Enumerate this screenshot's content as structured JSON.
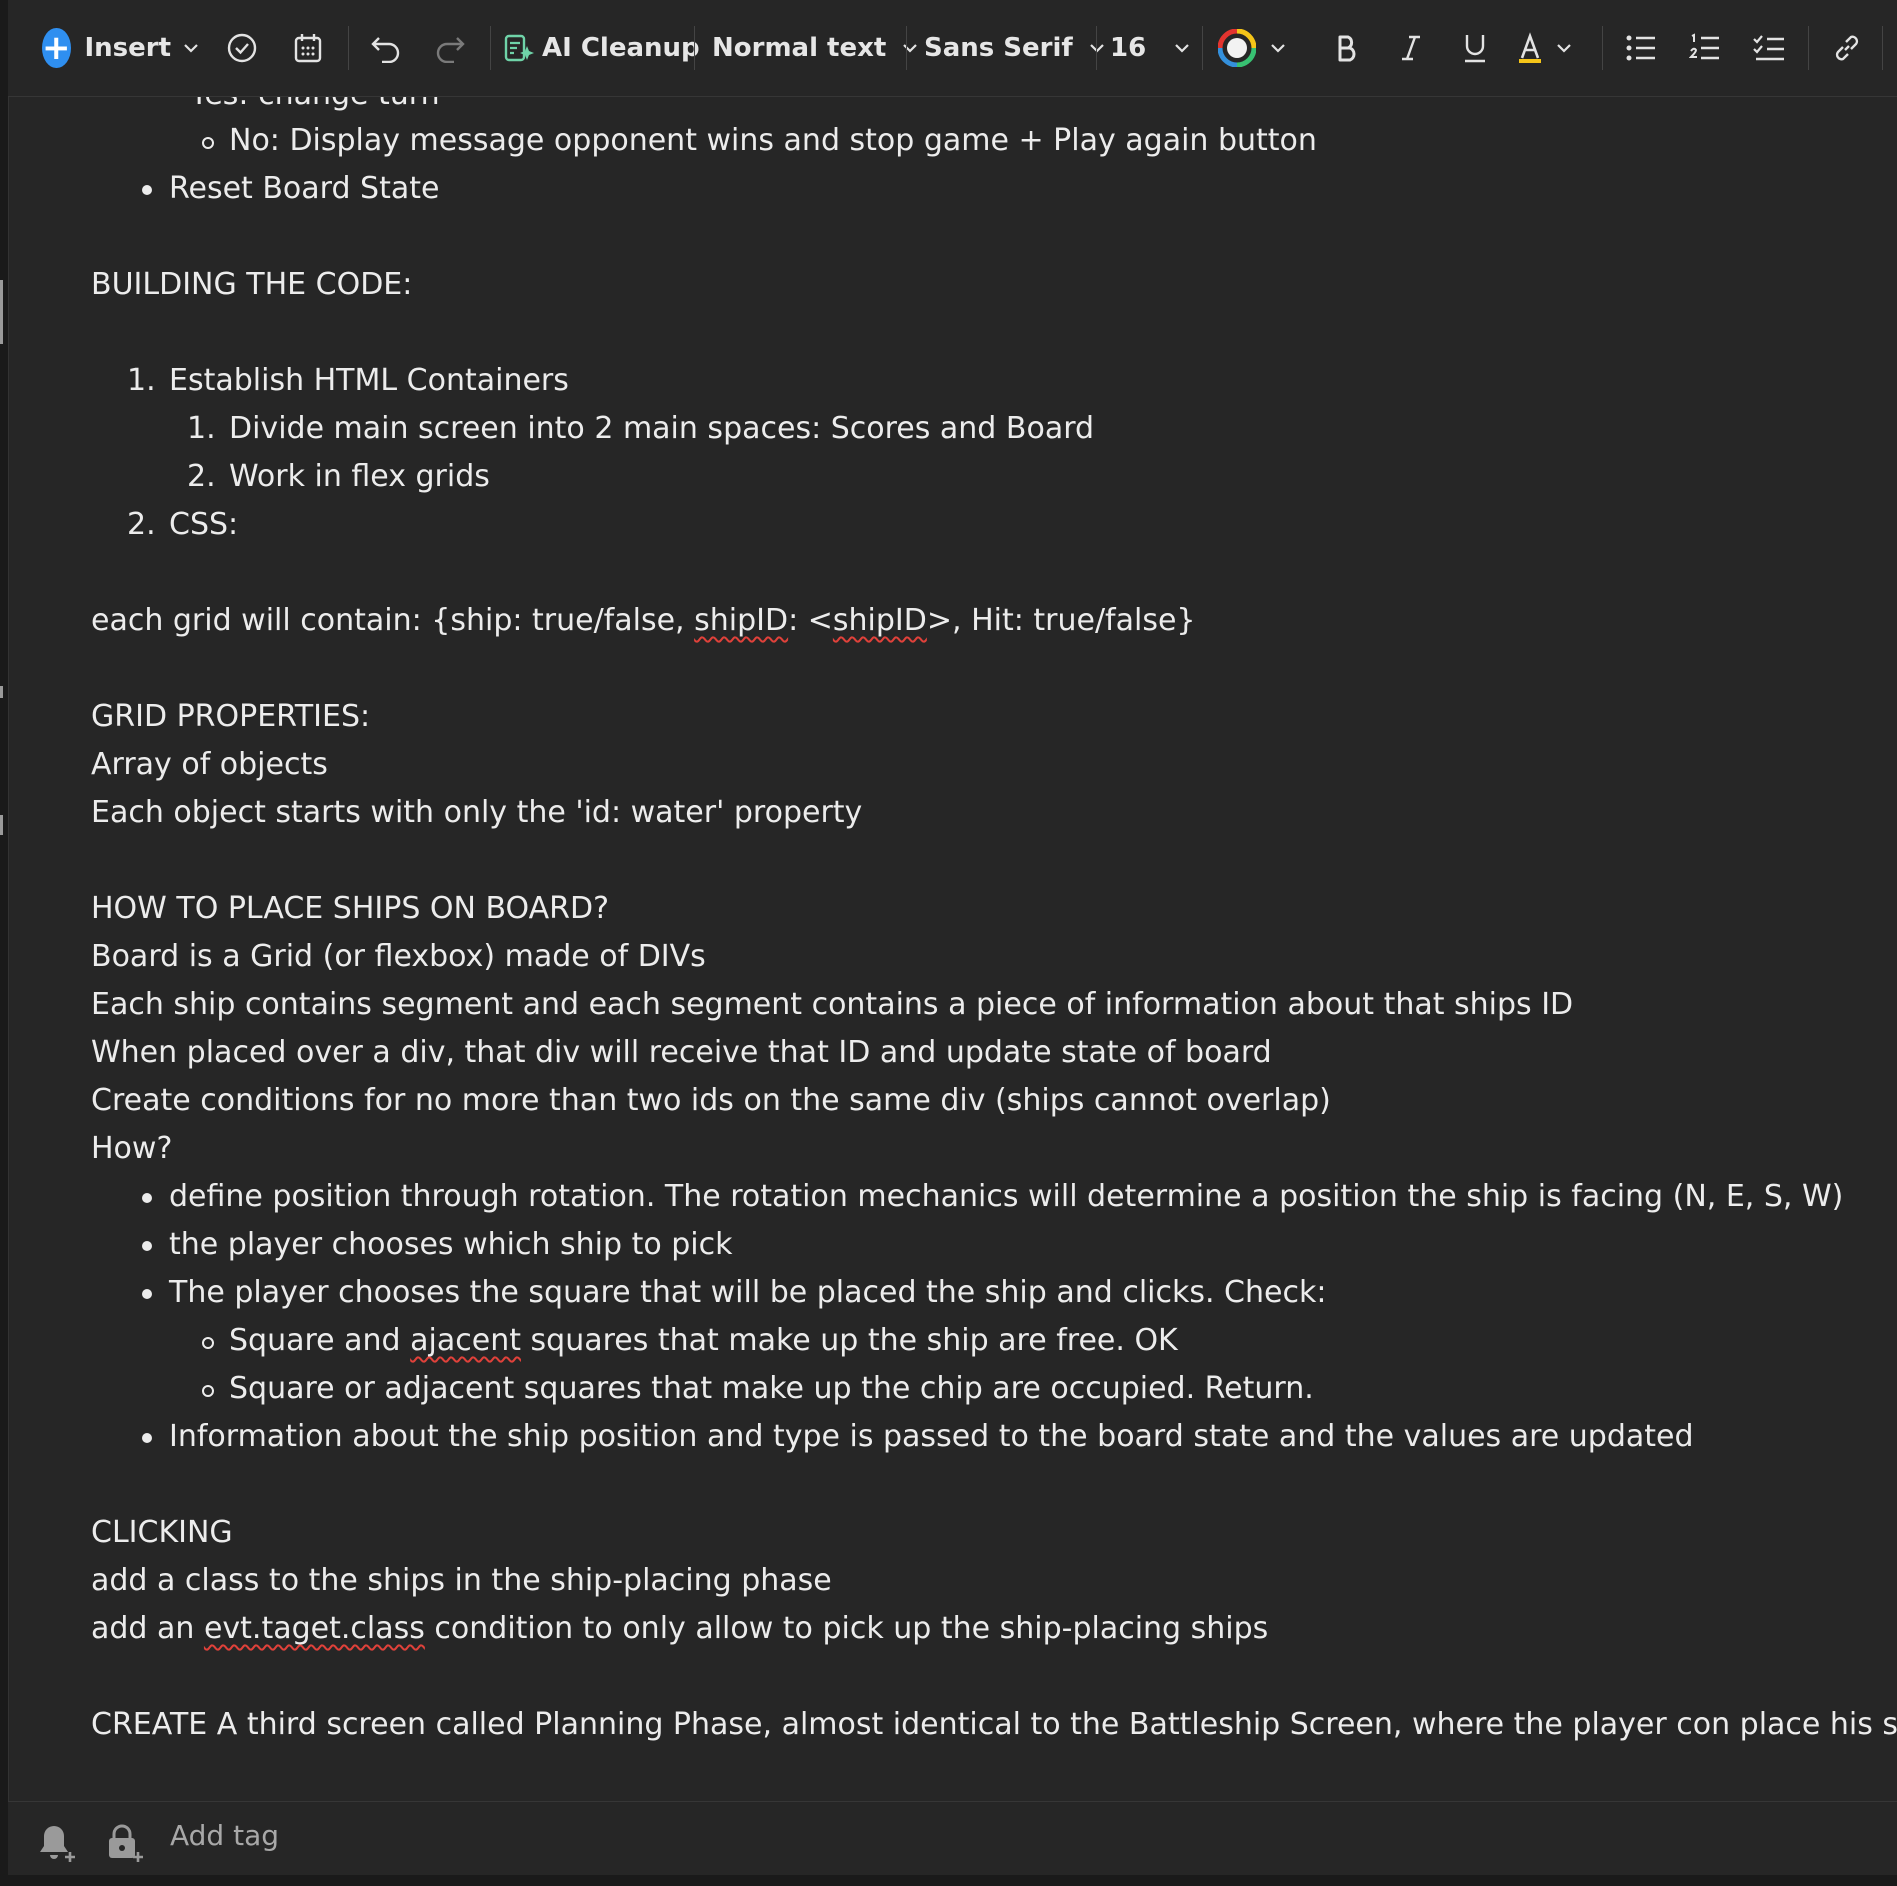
{
  "toolbar": {
    "insert_label": "Insert",
    "ai_cleanup_label": "AI Cleanup",
    "text_style": "Normal text",
    "font_name": "Sans Serif",
    "font_size": "16",
    "icons": [
      "plus-icon",
      "chevron-down-icon",
      "check-circle-icon",
      "calendar-icon",
      "undo-icon",
      "redo-icon",
      "ai-cleanup-icon",
      "color-ring-icon",
      "bold-icon",
      "italic-icon",
      "underline-icon",
      "highlight-icon",
      "bullet-list-icon",
      "numbered-list-icon",
      "checklist-icon",
      "link-icon"
    ],
    "accent_color": "#2f8ff0",
    "highlight_color": "#f5c518"
  },
  "doc": {
    "cut_top_line": "Yes: change turn",
    "sub1": "No: Display message opponent wins and stop game + Play again button",
    "b_reset": "Reset Board State",
    "building_heading": "BUILDING THE CODE:",
    "n1_marker": "1.",
    "n1": "Establish HTML Containers",
    "n1a_marker": "1.",
    "n1a": "Divide main screen into 2 main spaces:  Scores and Board",
    "n1b_marker": "2.",
    "n1b": "Work in flex grids",
    "n2_marker": "2.",
    "n2": "CSS:",
    "grid_a": "each grid will contain: {ship: true/false, ",
    "grid_b": "shipID",
    "grid_c": ": <",
    "grid_d": "shipID",
    "grid_e": ">, Hit: true/false}",
    "grid_props_heading": "GRID PROPERTIES:",
    "gp1": "Array of objects",
    "gp2": "Each object starts with only the 'id: water' property",
    "place_heading": "HOW TO PLACE SHIPS ON BOARD?",
    "p1": "Board is a Grid (or flexbox) made of DIVs",
    "p2": "Each ship contains segment and each segment contains a piece of information about that ships ID",
    "p3": "When placed over a div, that div will receive that ID and update state of board",
    "p4": "Create conditions for no more than two ids on the same div (ships cannot overlap)",
    "p5": "How?",
    "hb1": "define position through rotation. The rotation mechanics will determine a position the ship is facing (N, E, S, W)",
    "hb2": "the player chooses which ship to pick",
    "hb3": "The player chooses the square that will be placed the ship and clicks. Check:",
    "hs1a": "Square and ",
    "hs1b": "ajacent",
    "hs1c": " squares that make up the ship are free. OK",
    "hs2": "Square or adjacent squares that make up the chip are occupied. Return.",
    "hb4": "Information about the ship position and type is passed to the board state and the values are updated",
    "clicking_heading": "CLICKING",
    "c1": "add a class to the ships in the ship-placing phase",
    "c2a": "add an ",
    "c2b": "evt.taget.class",
    "c2c": " condition to only allow to pick up the ship-placing ships",
    "create_line": "CREATE A third screen called Planning Phase, almost identical to the Battleship Screen, where the player con place his ships."
  },
  "footer": {
    "add_tag_label": "Add tag",
    "icons": [
      "add-reminder-icon",
      "add-lock-icon"
    ]
  }
}
